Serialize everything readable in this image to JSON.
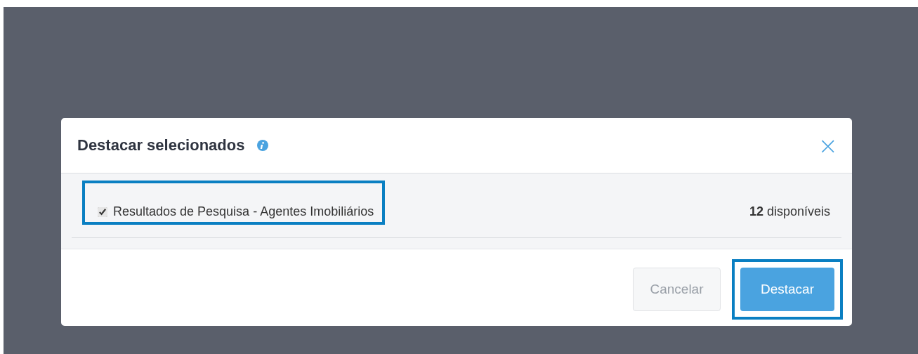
{
  "dialog": {
    "title": "Destacar selecionados",
    "close": "×"
  },
  "item": {
    "label": "Resultados de Pesquisa - Agentes Imobiliários",
    "checked": true,
    "highlighted": true,
    "count": "**12** disponíveis"
  },
  "buttons": [
    {
      "label": "Cancelar",
      "kind": "secondary",
      "highlighted": false
    },
    {
      "label": "Destacar",
      "kind": "primary",
      "highlighted": true
    }
  ]
}
